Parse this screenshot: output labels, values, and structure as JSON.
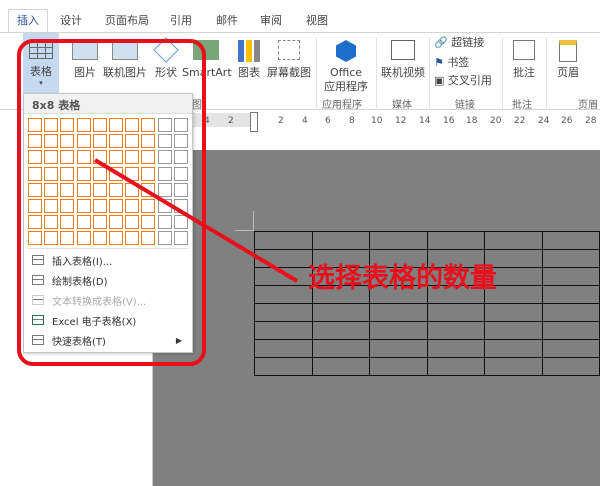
{
  "tabs": [
    "插入",
    "设计",
    "页面布局",
    "引用",
    "邮件",
    "审阅",
    "视图"
  ],
  "ribbon": {
    "table": "表格",
    "picture": "图片",
    "online_picture": "联机图片",
    "shapes": "形状",
    "smartart": "SmartArt",
    "chart": "图表",
    "screenshot": "屏幕截图",
    "office_apps_1": "Office",
    "office_apps_2": "应用程序",
    "online_video": "联机视频",
    "hyperlink": "超链接",
    "bookmark": "书签",
    "cross_ref": "交叉引用",
    "comment": "批注",
    "header": "页眉",
    "groups": {
      "illustrations": "图",
      "apps": "应用程序",
      "media": "媒体",
      "links": "链接",
      "comments": "批注",
      "header_footer": "页眉"
    }
  },
  "ruler": [
    "4",
    "2",
    "2",
    "4",
    "6",
    "8",
    "10",
    "12",
    "14",
    "16",
    "18",
    "20",
    "22",
    "24",
    "26",
    "28"
  ],
  "table_menu": {
    "header": "8x8 表格",
    "grid": {
      "columns": 10,
      "rows": 8,
      "selected_columns": 8,
      "selected_rows": 8
    },
    "items": [
      {
        "label": "插入表格(I)...",
        "enabled": true
      },
      {
        "label": "绘制表格(D)",
        "enabled": true
      },
      {
        "label": "文本转换成表格(V)...",
        "enabled": false
      },
      {
        "label": "Excel 电子表格(X)",
        "enabled": true
      },
      {
        "label": "快速表格(T)",
        "enabled": true
      }
    ]
  },
  "document_table": {
    "columns": 6,
    "rows": 8
  },
  "annotation": {
    "text": "选择表格的数量",
    "color": "#e8101c"
  },
  "colors": {
    "accent": "#2b579a",
    "grid_selected": "#f07a1e",
    "doc_bg": "#808080"
  }
}
